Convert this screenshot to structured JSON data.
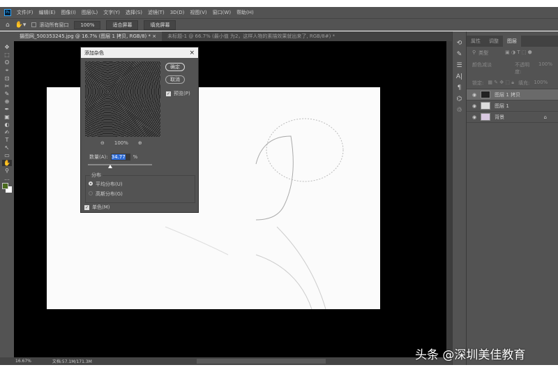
{
  "app": {
    "logo": "Ps"
  },
  "menu": [
    "文件(F)",
    "编辑(E)",
    "图像(I)",
    "图层(L)",
    "文字(Y)",
    "选择(S)",
    "滤镜(T)",
    "3D(D)",
    "视图(V)",
    "窗口(W)",
    "帮助(H)"
  ],
  "options": {
    "scroll_all": "滚动所有窗口",
    "zoom": "100%",
    "fit": "适合屏幕",
    "fill": "填充屏幕"
  },
  "tabs": [
    {
      "label": "摄图网_500353245.jpg @ 16.7% (图层 1 拷贝, RGB/8) *",
      "close": "×"
    },
    {
      "label": "未标题-1 @ 66.7% (最小值 为2，这样人物的素描效果就出来了, RGB/8#) *"
    }
  ],
  "tools": [
    "✥",
    "⬚",
    "ʘ",
    "⌖",
    "⊡",
    "✂",
    "✎",
    "⊕",
    "✒",
    "▣",
    "◐",
    "✍",
    "T",
    "↖",
    "▭",
    "✋",
    "⚲",
    "…"
  ],
  "dialog": {
    "title": "添加杂色",
    "close": "×",
    "ok": "确定",
    "cancel": "取消",
    "preview": "预览(P)",
    "zoom": "100%",
    "amount_label": "数量(A):",
    "amount": "34.77",
    "unit": "%",
    "amount_fraction": 0.35,
    "distribution": "分布",
    "uniform": "平均分布(U)",
    "gaussian": "高斯分布(G)",
    "selected": "uniform",
    "mono": "单色(M)",
    "mono_checked": true,
    "preview_checked": true
  },
  "panel": {
    "tabs": [
      "属性",
      "调整",
      "图层"
    ],
    "active": "图层",
    "kind": "类型",
    "blend": "颜色减淡",
    "opacity_label": "不透明度:",
    "opacity": "100%",
    "lock_label": "锁定:",
    "fill_label": "填充:",
    "fill": "100%",
    "layers": [
      {
        "name": "图层 1 拷贝",
        "selected": true
      },
      {
        "name": "图层 1"
      },
      {
        "name": "背景",
        "locked": true
      }
    ]
  },
  "status": {
    "zoom": "16.67%",
    "doc": "文档:57.1M/171.3M"
  },
  "watermark": "头条 @深圳美佳教育",
  "colors": {
    "accent": "#31a8ff",
    "foreground": "#4a6b1e",
    "background": "#ffffff"
  }
}
